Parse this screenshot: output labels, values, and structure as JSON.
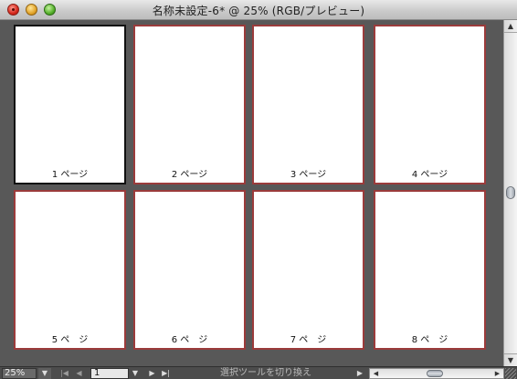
{
  "window": {
    "title": "名称未設定-6* @ 25% (RGB/プレビュー)"
  },
  "pages": [
    {
      "label": "1 ページ",
      "selected": true
    },
    {
      "label": "2 ページ",
      "selected": false
    },
    {
      "label": "3 ページ",
      "selected": false
    },
    {
      "label": "4 ページ",
      "selected": false
    },
    {
      "label": "5 ペ　ジ",
      "selected": false
    },
    {
      "label": "6 ペ　ジ",
      "selected": false
    },
    {
      "label": "7 ペ　ジ",
      "selected": false
    },
    {
      "label": "8 ペ　ジ",
      "selected": false
    }
  ],
  "statusbar": {
    "zoom": "25%",
    "page_number": "1",
    "status_text": "選択ツールを切り換え"
  },
  "colors": {
    "page_border": "#9b3b3b",
    "selected_border": "#111111",
    "canvas_bg": "#585858"
  }
}
